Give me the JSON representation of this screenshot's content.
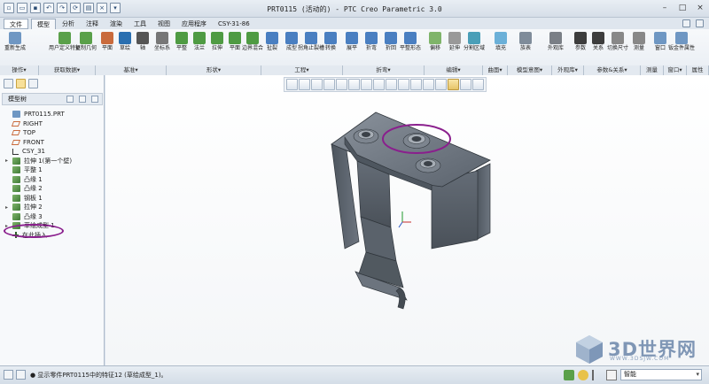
{
  "window": {
    "title": "PRT0115 (活动的) - PTC Creo Parametric 3.0"
  },
  "tabs": [
    "文件",
    "模型",
    "分析",
    "注释",
    "渲染",
    "工具",
    "视图",
    "应用程序",
    "CSY-31-86"
  ],
  "active_tab": "模型",
  "ribbon_buttons": [
    {
      "label": "重新生成",
      "icon": "regenerate-icon"
    },
    {
      "label": "用户定义特征",
      "icon": "udf-icon"
    },
    {
      "label": "复制几何",
      "icon": "copy-geometry-icon"
    },
    {
      "label": "平面",
      "icon": "plane-icon"
    },
    {
      "label": "草绘",
      "icon": "sketch-icon"
    },
    {
      "label": "轴",
      "icon": "axis-icon"
    },
    {
      "label": "坐标系",
      "icon": "csys-icon"
    },
    {
      "label": "平整",
      "icon": "flat-wall-icon"
    },
    {
      "label": "法兰",
      "icon": "flange-icon"
    },
    {
      "label": "拉伸",
      "icon": "extrude-icon"
    },
    {
      "label": "平面",
      "icon": "planar-icon"
    },
    {
      "label": "边界混合",
      "icon": "boundary-blend-icon"
    },
    {
      "label": "扯裂",
      "icon": "rip-icon"
    },
    {
      "label": "成型",
      "icon": "form-icon"
    },
    {
      "label": "拐角止裂槽",
      "icon": "corner-relief-icon"
    },
    {
      "label": "转换",
      "icon": "convert-icon"
    },
    {
      "label": "展平",
      "icon": "unbend-icon"
    },
    {
      "label": "折弯",
      "icon": "bend-icon"
    },
    {
      "label": "折回",
      "icon": "bend-back-icon"
    },
    {
      "label": "平整形态",
      "icon": "flat-pattern-icon"
    },
    {
      "label": "偏移",
      "icon": "offset-icon"
    },
    {
      "label": "延伸",
      "icon": "extend-icon"
    },
    {
      "label": "分割区域",
      "icon": "split-area-icon"
    },
    {
      "label": "填充",
      "icon": "fill-icon"
    },
    {
      "label": "族表",
      "icon": "family-table-icon"
    },
    {
      "label": "外观库",
      "icon": "appearance-icon"
    },
    {
      "label": "参数",
      "icon": "parameters-icon"
    },
    {
      "label": "关系",
      "icon": "relations-icon"
    },
    {
      "label": "切换尺寸",
      "icon": "switch-dimensions-icon"
    },
    {
      "label": "测量",
      "icon": "measure-icon"
    },
    {
      "label": "窗口",
      "icon": "window-icon"
    },
    {
      "label": "钣金件属性",
      "icon": "sheetmetal-properties-icon"
    }
  ],
  "ribbon_groups": [
    "操作▾",
    "获取数据▾",
    "基准▾",
    "形状▾",
    "工程▾",
    "折弯▾",
    "编辑▾",
    "曲面▾",
    "模型意图▾",
    "外观库▾",
    "参数&关系▾",
    "测量",
    "窗口▾",
    "属性"
  ],
  "model_tree": {
    "header": "模型树",
    "items": [
      {
        "label": "PRT0115.PRT",
        "icon": "part-icon",
        "expand": ""
      },
      {
        "label": "RIGHT",
        "icon": "datum-plane-icon",
        "expand": ""
      },
      {
        "label": "TOP",
        "icon": "datum-plane-icon",
        "expand": ""
      },
      {
        "label": "FRONT",
        "icon": "datum-plane-icon",
        "expand": ""
      },
      {
        "label": "CSY_31",
        "icon": "csys-icon",
        "expand": ""
      },
      {
        "label": "拉伸 1(第一个壁)",
        "icon": "extrude-icon",
        "expand": "▸"
      },
      {
        "label": "平整 1",
        "icon": "flat-icon",
        "expand": ""
      },
      {
        "label": "凸缘 1",
        "icon": "flange-icon",
        "expand": ""
      },
      {
        "label": "凸缘 2",
        "icon": "flange-icon",
        "expand": ""
      },
      {
        "label": "钢板 1",
        "icon": "sheet-icon",
        "expand": ""
      },
      {
        "label": "拉伸 2",
        "icon": "extrude-icon",
        "expand": "▸"
      },
      {
        "label": "凸缘 3",
        "icon": "flange-icon",
        "expand": ""
      },
      {
        "label": "草绘成型 1",
        "icon": "sketched-form-icon",
        "expand": "▸"
      },
      {
        "label": "在此插入",
        "icon": "insert-here-icon",
        "expand": ""
      }
    ]
  },
  "status": {
    "message": "● 显示零件PRT0115中的特征12 (草绘成型_1)。",
    "filter": "智能"
  },
  "watermark": {
    "text": "3D世界网",
    "url": "WWW.3DSJW.COM"
  },
  "colors": {
    "highlight": "#8a1f8d",
    "model": "#5f6873",
    "accent": "#2a4b73"
  }
}
